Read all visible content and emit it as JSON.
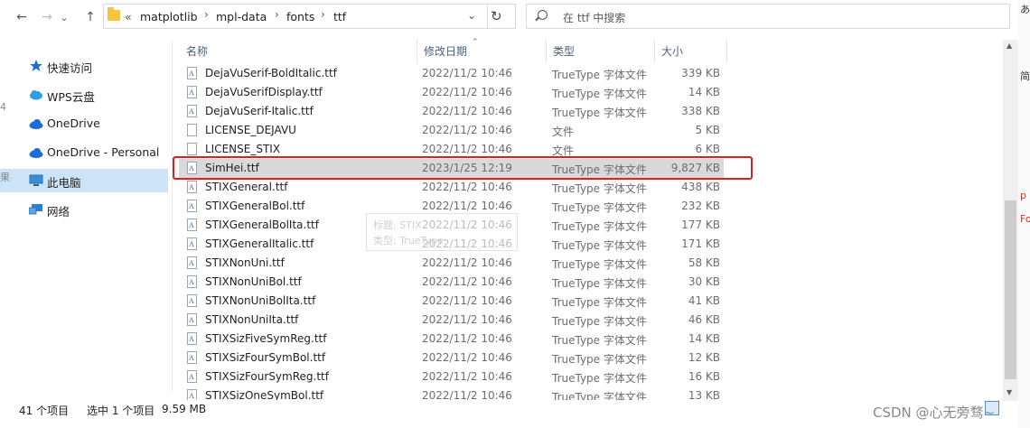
{
  "nav": {
    "back": "←",
    "forward": "→",
    "recent": "⌄",
    "up": "↑",
    "overflow": "«",
    "breadcrumbs": [
      "matplotlib",
      "mpl-data",
      "fonts",
      "ttf"
    ],
    "dropdown": "⌄",
    "refresh": "↻"
  },
  "search": {
    "placeholder": "在 ttf 中搜索"
  },
  "sidebar": {
    "items": [
      {
        "label": "快速访问",
        "icon": "star-icon",
        "color": "#1f6fd1"
      },
      {
        "label": "WPS云盘",
        "icon": "cloud-icon",
        "color": "#2a9fe6"
      },
      {
        "label": "OneDrive",
        "icon": "cloud-icon",
        "color": "#1b6fd1"
      },
      {
        "label": "OneDrive - Personal",
        "icon": "cloud-icon",
        "color": "#1b6fd1"
      },
      {
        "label": "此电脑",
        "icon": "computer-icon",
        "color": "#3a8ed8",
        "selected": true
      },
      {
        "label": "网络",
        "icon": "network-icon",
        "color": "#2a7fd1"
      }
    ]
  },
  "columns": {
    "name": "名称",
    "date": "修改日期",
    "type": "类型",
    "size": "大小"
  },
  "files": [
    {
      "name": "DejaVuSerif-BoldItalic.ttf",
      "date": "2022/11/2 10:46",
      "type": "TrueType 字体文件",
      "size": "339 KB",
      "icon": "font-file-icon"
    },
    {
      "name": "DejaVuSerifDisplay.ttf",
      "date": "2022/11/2 10:46",
      "type": "TrueType 字体文件",
      "size": "14 KB",
      "icon": "font-file-icon"
    },
    {
      "name": "DejaVuSerif-Italic.ttf",
      "date": "2022/11/2 10:46",
      "type": "TrueType 字体文件",
      "size": "338 KB",
      "icon": "font-file-icon"
    },
    {
      "name": "LICENSE_DEJAVU",
      "date": "2022/11/2 10:46",
      "type": "文件",
      "size": "5 KB",
      "icon": "file-icon"
    },
    {
      "name": "LICENSE_STIX",
      "date": "2022/11/2 10:46",
      "type": "文件",
      "size": "6 KB",
      "icon": "file-icon"
    },
    {
      "name": "SimHei.ttf",
      "date": "2023/1/25 12:19",
      "type": "TrueType 字体文件",
      "size": "9,827 KB",
      "icon": "font-file-icon",
      "selected": true
    },
    {
      "name": "STIXGeneral.ttf",
      "date": "2022/11/2 10:46",
      "type": "TrueType 字体文件",
      "size": "438 KB",
      "icon": "font-file-icon"
    },
    {
      "name": "STIXGeneralBol.ttf",
      "date": "2022/11/2 10:46",
      "type": "TrueType 字体文件",
      "size": "232 KB",
      "icon": "font-file-icon"
    },
    {
      "name": "STIXGeneralBolIta.ttf",
      "date": "2022/11/2 10:46",
      "type": "TrueType 字体文件",
      "size": "177 KB",
      "icon": "font-file-icon"
    },
    {
      "name": "STIXGeneralItalic.ttf",
      "date": "2022/11/2 10:46",
      "type": "TrueType 字体文件",
      "size": "171 KB",
      "icon": "font-file-icon"
    },
    {
      "name": "STIXNonUni.ttf",
      "date": "2022/11/2 10:46",
      "type": "TrueType 字体文件",
      "size": "58 KB",
      "icon": "font-file-icon"
    },
    {
      "name": "STIXNonUniBol.ttf",
      "date": "2022/11/2 10:46",
      "type": "TrueType 字体文件",
      "size": "30 KB",
      "icon": "font-file-icon"
    },
    {
      "name": "STIXNonUniBolIta.ttf",
      "date": "2022/11/2 10:46",
      "type": "TrueType 字体文件",
      "size": "41 KB",
      "icon": "font-file-icon"
    },
    {
      "name": "STIXNonUniIta.ttf",
      "date": "2022/11/2 10:46",
      "type": "TrueType 字体文件",
      "size": "46 KB",
      "icon": "font-file-icon"
    },
    {
      "name": "STIXSizFiveSymReg.ttf",
      "date": "2022/11/2 10:46",
      "type": "TrueType 字体文件",
      "size": "14 KB",
      "icon": "font-file-icon"
    },
    {
      "name": "STIXSizFourSymBol.ttf",
      "date": "2022/11/2 10:46",
      "type": "TrueType 字体文件",
      "size": "12 KB",
      "icon": "font-file-icon"
    },
    {
      "name": "STIXSizFourSymReg.ttf",
      "date": "2022/11/2 10:46",
      "type": "TrueType 字体文件",
      "size": "16 KB",
      "icon": "font-file-icon"
    },
    {
      "name": "STIXSizOneSymBol.ttf",
      "date": "2022/11/2 10:46",
      "type": "TrueType 字体文件",
      "size": "13 KB",
      "icon": "font-file-icon"
    }
  ],
  "tooltip": {
    "line1": "标题: STIX",
    "line2": "类型: TrueType"
  },
  "status": {
    "item_count": "41 个项目",
    "selected": "选中 1 个项目",
    "selected_size": "9.59 MB"
  },
  "watermark": "CSDN @心无旁骛~",
  "edge_text": {
    "top": "あ",
    "mid1": "简",
    "mid2": "p",
    "mid3": "Fo"
  },
  "left_edge": {
    "a": "4",
    "b": "果"
  },
  "colors": {
    "selection_red": "#e02020",
    "selected_row": "#d9d9d9",
    "sidebar_selected": "#cce4f7"
  }
}
